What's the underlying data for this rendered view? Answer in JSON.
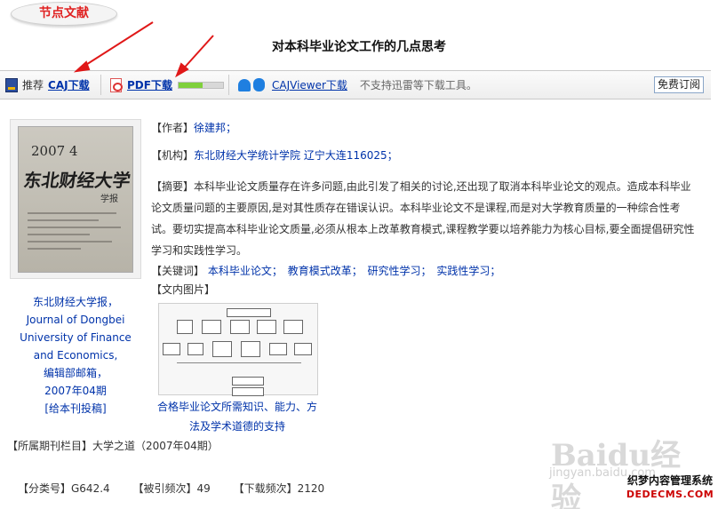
{
  "badge": "节点文献",
  "title": "对本科毕业论文工作的几点思考",
  "download_bar": {
    "caj_prefix": "推荐",
    "caj_link": "CAJ下载",
    "pdf_link": "PDF下载",
    "pdf_progress": 0.55,
    "cajviewer_link": "CAJViewer下载",
    "notice": "不支持迅雷等下载工具。",
    "subscribe": "免费订阅"
  },
  "journal": {
    "cover_issue": "2007 4",
    "cover_name": "东北财经大学",
    "cover_sub": "学报",
    "lines": [
      "东北财经大学报，",
      "Journal of Dongbei",
      "University of Finance",
      "and Economics,",
      "编辑部邮箱，",
      "2007年04期",
      "[给本刊投稿]"
    ]
  },
  "author": {
    "label": "【作者】",
    "value": "徐建邦；"
  },
  "org": {
    "label": "【机构】",
    "value": "东北财经大学统计学院 辽宁大连116025；"
  },
  "abstract": {
    "label": "【摘要】",
    "text": "本科毕业论文质量存在许多问题,由此引发了相关的讨论,还出现了取消本科毕业论文的观点。造成本科毕业论文质量问题的主要原因,是对其性质存在错误认识。本科毕业论文不是课程,而是对大学教育质量的一种综合性考试。要切实提高本科毕业论文质量,必须从根本上改革教育模式,课程教学要以培养能力为核心目标,要全面提倡研究性学习和实践性学习。"
  },
  "keywords": {
    "label": "【关键词】",
    "items": [
      "本科毕业论文；",
      "教育模式改革；",
      "研究性学习；",
      "实践性学习；"
    ]
  },
  "figures": {
    "label": "【文内图片】",
    "caption_1": "合格毕业论文所需知识、能力、方",
    "caption_2": "法及学术道德的支持"
  },
  "column": "【所属期刊栏目】大学之道（2007年04期）",
  "stats": {
    "cls": "【分类号】G642.4",
    "cited": "【被引频次】49",
    "downloads": "【下载频次】2120"
  },
  "watermark": {
    "main": "Baidu经验",
    "sub": "jingyan.baidu.com"
  },
  "site_logo": {
    "name": "织梦内容管理系统",
    "domain": "DEDECMS.COM"
  },
  "colors": {
    "link": "#0033aa",
    "badge": "#e02222",
    "arrow": "#e01818",
    "progress": "#7fd03c"
  }
}
